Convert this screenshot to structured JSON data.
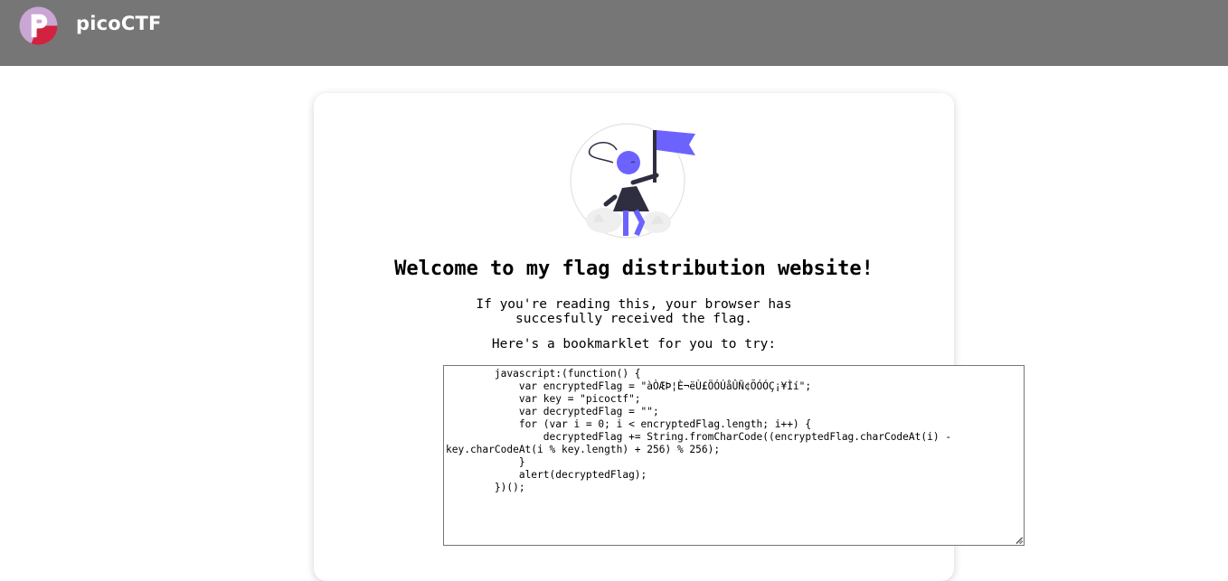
{
  "header": {
    "brand": "picoCTF",
    "background_color": "#767676",
    "logo_icon": "picoctf-logo-icon",
    "logo_colors": {
      "circle": "#c9a6d4",
      "accent": "#d1233f",
      "letter": "#ffffff"
    }
  },
  "main": {
    "illustration_icon": "person-with-flag-illustration",
    "accent_color": "#6c63ff",
    "title": "Welcome to my flag distribution website!",
    "message_lines": [
      "If you're reading this, your browser has",
      "succesfully received the flag."
    ],
    "bookmarklet_label": "Here's a bookmarklet for you to try:",
    "bookmarklet_code": "        javascript:(function() {\n            var encryptedFlag = \"àÒÆÞ¦È¬ëÙ£ÖÓÚåÛÑ¢ÕÓÓÇ¡¥Ìí\";\n            var key = \"picoctf\";\n            var decryptedFlag = \"\";\n            for (var i = 0; i < encryptedFlag.length; i++) {\n                decryptedFlag += String.fromCharCode((encryptedFlag.charCodeAt(i) - key.charCodeAt(i % key.length) + 256) % 256);\n            }\n            alert(decryptedFlag);\n        })();"
  }
}
